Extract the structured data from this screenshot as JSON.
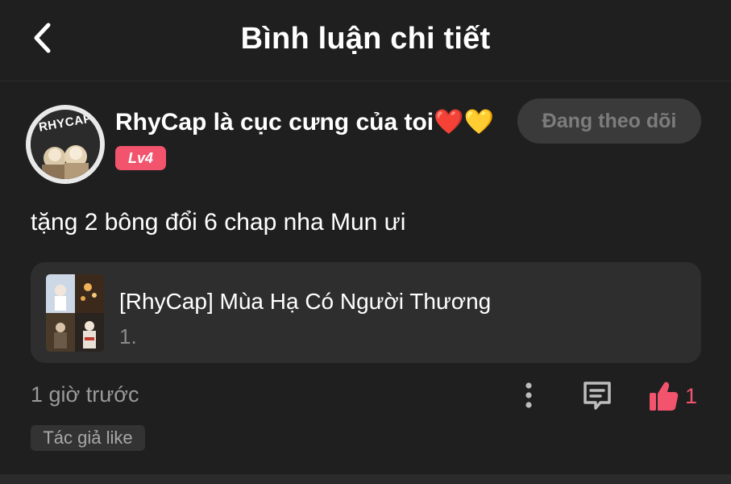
{
  "header": {
    "title": "Bình luận chi tiết",
    "back_icon": "chevron-left-icon"
  },
  "comment": {
    "avatar_text": "RHYCAP",
    "username": "RhyCap là cục cưng của toi❤️💛",
    "level": "Lv4",
    "follow_label": "Đang theo dõi",
    "text": "tặng 2 bông đổi 6 chap nha Mun ưi",
    "story": {
      "title": "[RhyCap] Mùa Hạ Có Người Thương",
      "chapter": "1."
    },
    "timestamp": "1 giờ trước",
    "like_count": "1",
    "author_badge": "Tác giả like",
    "icons": {
      "more": "more-vertical-icon",
      "reply": "comment-icon",
      "like": "thumbs-up-icon"
    }
  },
  "colors": {
    "background": "#1f1f1f",
    "accent": "#f2536d",
    "card": "#2e2e2e",
    "muted_text": "#9a9a9a"
  }
}
